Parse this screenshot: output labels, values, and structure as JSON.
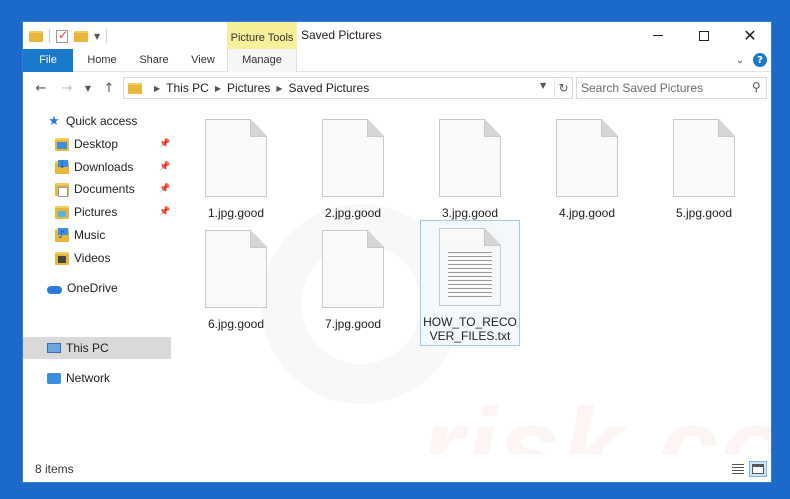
{
  "window": {
    "title": "Saved Pictures",
    "contextual_tab_group": "Picture Tools"
  },
  "ribbon": {
    "tabs": [
      {
        "label": "File"
      },
      {
        "label": "Home"
      },
      {
        "label": "Share"
      },
      {
        "label": "View"
      },
      {
        "label": "Manage"
      }
    ]
  },
  "address": {
    "crumbs": [
      "This PC",
      "Pictures",
      "Saved Pictures"
    ]
  },
  "search": {
    "placeholder": "Search Saved Pictures"
  },
  "sidebar": {
    "items": [
      {
        "label": "Quick access"
      },
      {
        "label": "Desktop"
      },
      {
        "label": "Downloads"
      },
      {
        "label": "Documents"
      },
      {
        "label": "Pictures"
      },
      {
        "label": "Music"
      },
      {
        "label": "Videos"
      },
      {
        "label": "OneDrive"
      },
      {
        "label": "This PC"
      },
      {
        "label": "Network"
      }
    ]
  },
  "files": [
    {
      "name": "1.jpg.good"
    },
    {
      "name": "2.jpg.good"
    },
    {
      "name": "3.jpg.good"
    },
    {
      "name": "4.jpg.good"
    },
    {
      "name": "5.jpg.good"
    },
    {
      "name": "6.jpg.good"
    },
    {
      "name": "7.jpg.good"
    },
    {
      "name": "HOW_TO_RECOVER_FILES.txt"
    }
  ],
  "status": {
    "item_count": "8 items"
  },
  "watermark": {
    "text": "risk.com"
  },
  "colors": {
    "desktop_bg": "#1b6ac9",
    "file_tab": "#1979ca",
    "picture_tools": "#f8ef9b",
    "selected_nav": "#d9d9d9"
  }
}
